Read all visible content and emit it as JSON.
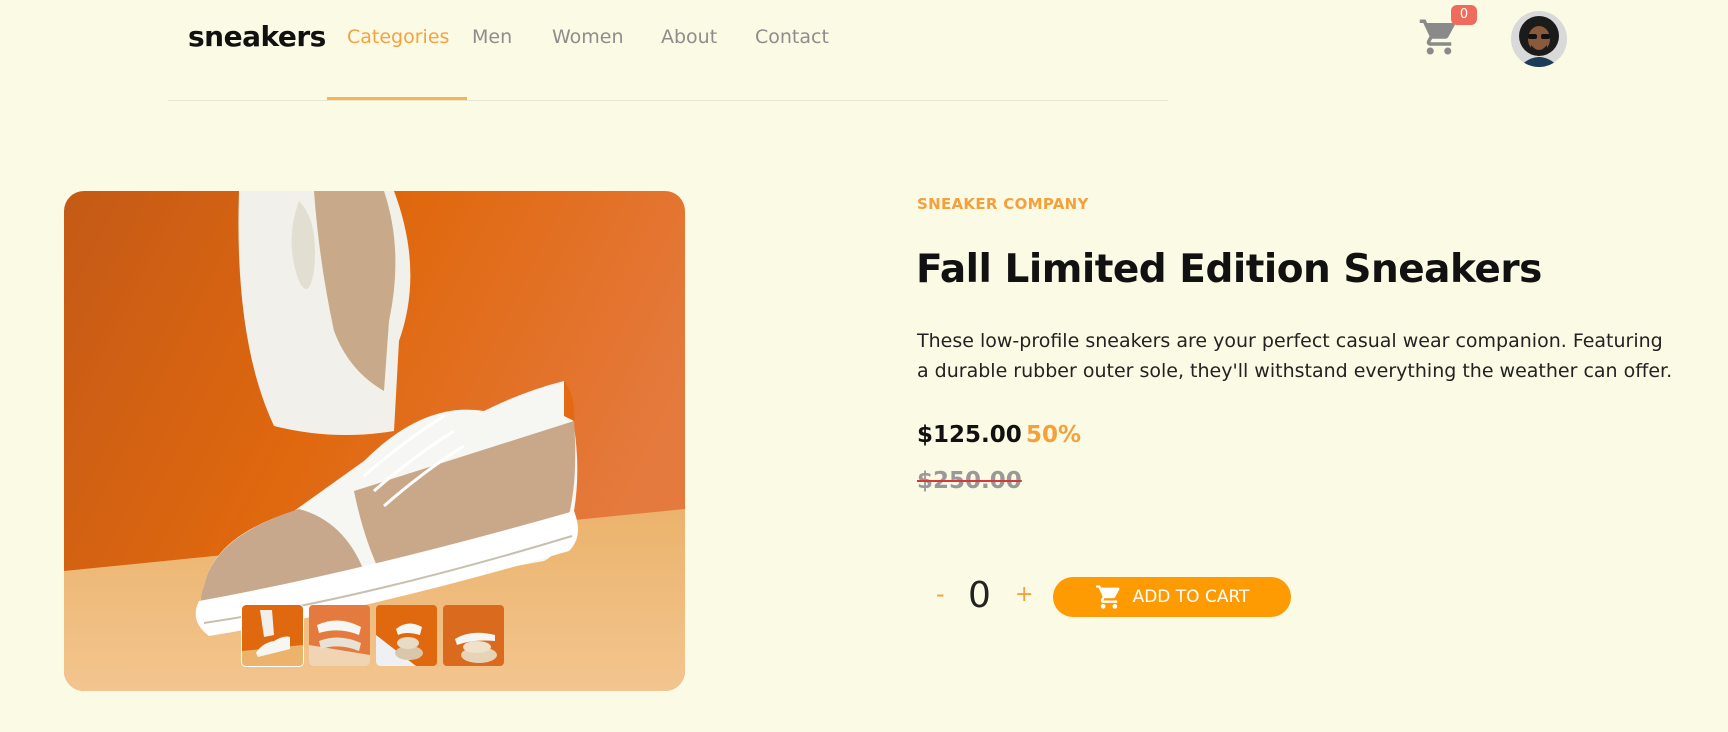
{
  "brand": {
    "logo": "sneakers"
  },
  "nav": {
    "items": [
      {
        "label": "Categories",
        "active": true
      },
      {
        "label": "Men"
      },
      {
        "label": "Women"
      },
      {
        "label": "About"
      },
      {
        "label": "Contact"
      }
    ]
  },
  "header": {
    "cart_icon": "cart-icon",
    "cart_count": "0",
    "avatar": "user-avatar"
  },
  "product": {
    "company": "SNEAKER COMPANY",
    "title": "Fall Limited Edition Sneakers",
    "description": "These low-profile sneakers are your perfect casual wear companion. Featuring a durable rubber outer sole, they'll withstand everything the weather can offer.",
    "price": "$125.00",
    "discount": "50%",
    "original_price": "$250.00",
    "quantity": "0",
    "minus_label": "-",
    "plus_label": "+",
    "add_to_cart_label": "ADD TO CART"
  },
  "gallery": {
    "thumbnails": 4,
    "selected_thumbnail": 1
  },
  "colors": {
    "background": "#fafae5",
    "accent": "#fe9b02",
    "accent_text": "#f5a03a",
    "badge": "#ef6b5b"
  }
}
